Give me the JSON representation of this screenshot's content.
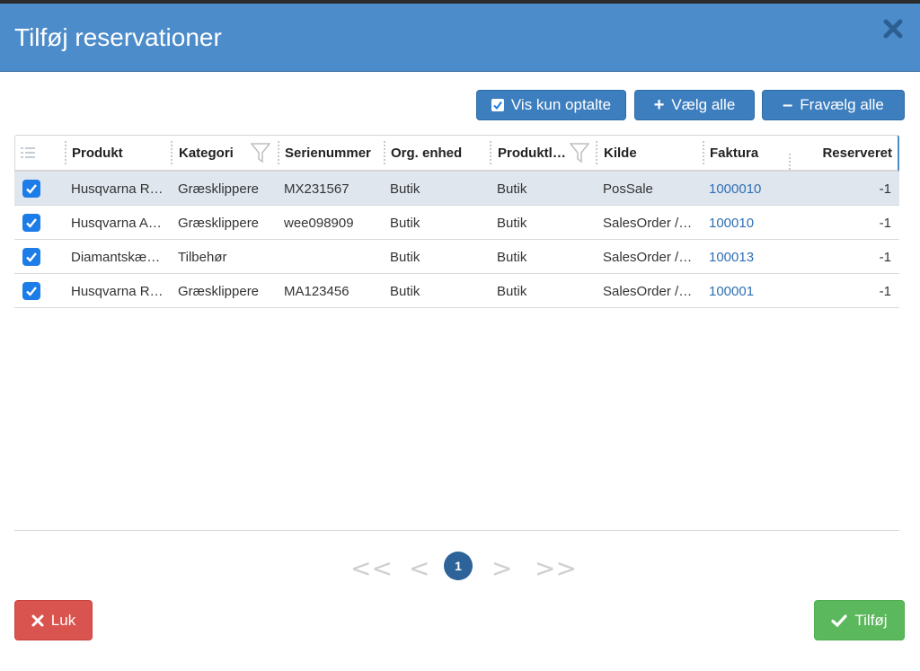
{
  "dialog": {
    "title": "Tilføj reservationer",
    "close_icon": "close-icon"
  },
  "toolbar": {
    "show_counted_label": "Vis kun optalte",
    "show_counted_checked": true,
    "select_all_label": "Vælg alle",
    "deselect_all_label": "Fravælg alle"
  },
  "table": {
    "columns": [
      {
        "key": "menu",
        "label": ""
      },
      {
        "key": "produkt",
        "label": "Produkt"
      },
      {
        "key": "kategori",
        "label": "Kategori",
        "filter": true
      },
      {
        "key": "serienummer",
        "label": "Serienummer"
      },
      {
        "key": "org_enhed",
        "label": "Org. enhed"
      },
      {
        "key": "produktl",
        "label": "Produktl…",
        "filter": true
      },
      {
        "key": "kilde",
        "label": "Kilde"
      },
      {
        "key": "faktura",
        "label": "Faktura"
      },
      {
        "key": "reserveret",
        "label": "Reserveret"
      }
    ],
    "rows": [
      {
        "checked": true,
        "selected": true,
        "produkt": "Husqvarna R…",
        "kategori": "Græsklippere",
        "serienummer": "MX231567",
        "org_enhed": "Butik",
        "produktl": "Butik",
        "kilde": "PosSale",
        "faktura": "1000010",
        "reserveret": "-1"
      },
      {
        "checked": true,
        "selected": false,
        "produkt": "Husqvarna A…",
        "kategori": "Græsklippere",
        "serienummer": "wee098909",
        "org_enhed": "Butik",
        "produktl": "Butik",
        "kilde": "SalesOrder /…",
        "faktura": "100010",
        "reserveret": "-1"
      },
      {
        "checked": true,
        "selected": false,
        "produkt": "Diamantskæ…",
        "kategori": "Tilbehør",
        "serienummer": "",
        "org_enhed": "Butik",
        "produktl": "Butik",
        "kilde": "SalesOrder /…",
        "faktura": "100013",
        "reserveret": "-1"
      },
      {
        "checked": true,
        "selected": false,
        "produkt": "Husqvarna R…",
        "kategori": "Græsklippere",
        "serienummer": "MA123456",
        "org_enhed": "Butik",
        "produktl": "Butik",
        "kilde": "SalesOrder /…",
        "faktura": "100001",
        "reserveret": "-1"
      }
    ]
  },
  "pager": {
    "first": "<<",
    "prev": "<",
    "current": "1",
    "next": ">",
    "last": ">>"
  },
  "footer": {
    "close_label": "Luk",
    "add_label": "Tilføj"
  },
  "colors": {
    "header_bg": "#4d8ccb",
    "primary_button": "#3d7ebf",
    "danger_button": "#d9534f",
    "success_button": "#5cb85c",
    "selected_row": "#dfe6ee",
    "link": "#2f6fb5",
    "checkbox": "#1c7ce8"
  }
}
